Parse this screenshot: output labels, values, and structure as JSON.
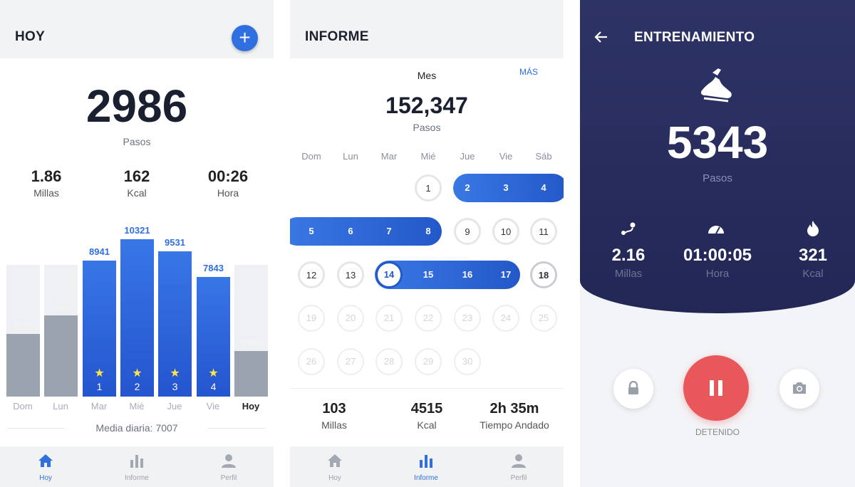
{
  "colors": {
    "accent": "#2f6fe0",
    "bar_active": "#2b5fd9",
    "bar_inactive": "#9aa3ae",
    "workout_bg": "#2a2e5e",
    "stop_red": "#e8575a"
  },
  "today": {
    "title": "HOY",
    "add_icon": "plus-icon",
    "steps": "2986",
    "steps_label": "Pasos",
    "stats": [
      {
        "value": "1.86",
        "unit": "Millas"
      },
      {
        "value": "162",
        "unit": "Kcal"
      },
      {
        "value": "00:26",
        "unit": "Hora"
      }
    ],
    "bars": [
      {
        "day": "Dom",
        "value": "4121",
        "steps": 4121,
        "active": false,
        "rank": ""
      },
      {
        "day": "Lun",
        "value": "5311",
        "steps": 5311,
        "active": false,
        "rank": ""
      },
      {
        "day": "Mar",
        "value": "8941",
        "steps": 8941,
        "active": true,
        "rank": "1"
      },
      {
        "day": "Mié",
        "value": "10321",
        "steps": 10321,
        "active": true,
        "rank": "2"
      },
      {
        "day": "Jue",
        "value": "9531",
        "steps": 9531,
        "active": true,
        "rank": "3"
      },
      {
        "day": "Vie",
        "value": "7843",
        "steps": 7843,
        "active": true,
        "rank": "4"
      },
      {
        "day": "Hoy",
        "value": "2986",
        "steps": 2986,
        "active": false,
        "rank": ""
      }
    ],
    "daily_avg": "Media diaria: 7007"
  },
  "report": {
    "title": "INFORME",
    "period": "Mes",
    "more": "MÁS",
    "steps": "152,347",
    "steps_label": "Pasos",
    "weekdays": [
      "Dom",
      "Lun",
      "Mar",
      "Mié",
      "Jue",
      "Vie",
      "Sáb"
    ],
    "days": [
      {
        "n": "1"
      },
      {
        "n": "2"
      },
      {
        "n": "3"
      },
      {
        "n": "4"
      },
      {
        "n": "5"
      },
      {
        "n": "6"
      },
      {
        "n": "7"
      },
      {
        "n": "8"
      },
      {
        "n": "9"
      },
      {
        "n": "10"
      },
      {
        "n": "11"
      },
      {
        "n": "12"
      },
      {
        "n": "13"
      },
      {
        "n": "14"
      },
      {
        "n": "15"
      },
      {
        "n": "16"
      },
      {
        "n": "17"
      },
      {
        "n": "18"
      },
      {
        "n": "19"
      },
      {
        "n": "20"
      },
      {
        "n": "21"
      },
      {
        "n": "22"
      },
      {
        "n": "23"
      },
      {
        "n": "24"
      },
      {
        "n": "25"
      },
      {
        "n": "26"
      },
      {
        "n": "27"
      },
      {
        "n": "28"
      },
      {
        "n": "29"
      },
      {
        "n": "30"
      }
    ],
    "totals": [
      {
        "value": "103",
        "unit": "Millas"
      },
      {
        "value": "4515",
        "unit": "Kcal"
      },
      {
        "value": "2h 35m",
        "unit": "Tiempo Andado"
      }
    ]
  },
  "workout": {
    "title": "ENTRENAMIENTO",
    "back_icon": "arrow-left-icon",
    "shoe_icon": "shoe-icon",
    "steps": "5343",
    "steps_label": "Pasos",
    "stats": [
      {
        "icon": "route-icon",
        "value": "2.16",
        "unit": "Millas"
      },
      {
        "icon": "speedometer-icon",
        "value": "01:00:05",
        "unit": "Hora"
      },
      {
        "icon": "flame-icon",
        "value": "321",
        "unit": "Kcal"
      }
    ],
    "status": "DETENIDO",
    "lock_icon": "lock-icon",
    "pause_icon": "pause-icon",
    "camera_icon": "camera-icon"
  },
  "nav": [
    {
      "label": "Hoy",
      "icon": "home-icon"
    },
    {
      "label": "Informe",
      "icon": "bar-chart-icon"
    },
    {
      "label": "Perfil",
      "icon": "person-icon"
    }
  ]
}
